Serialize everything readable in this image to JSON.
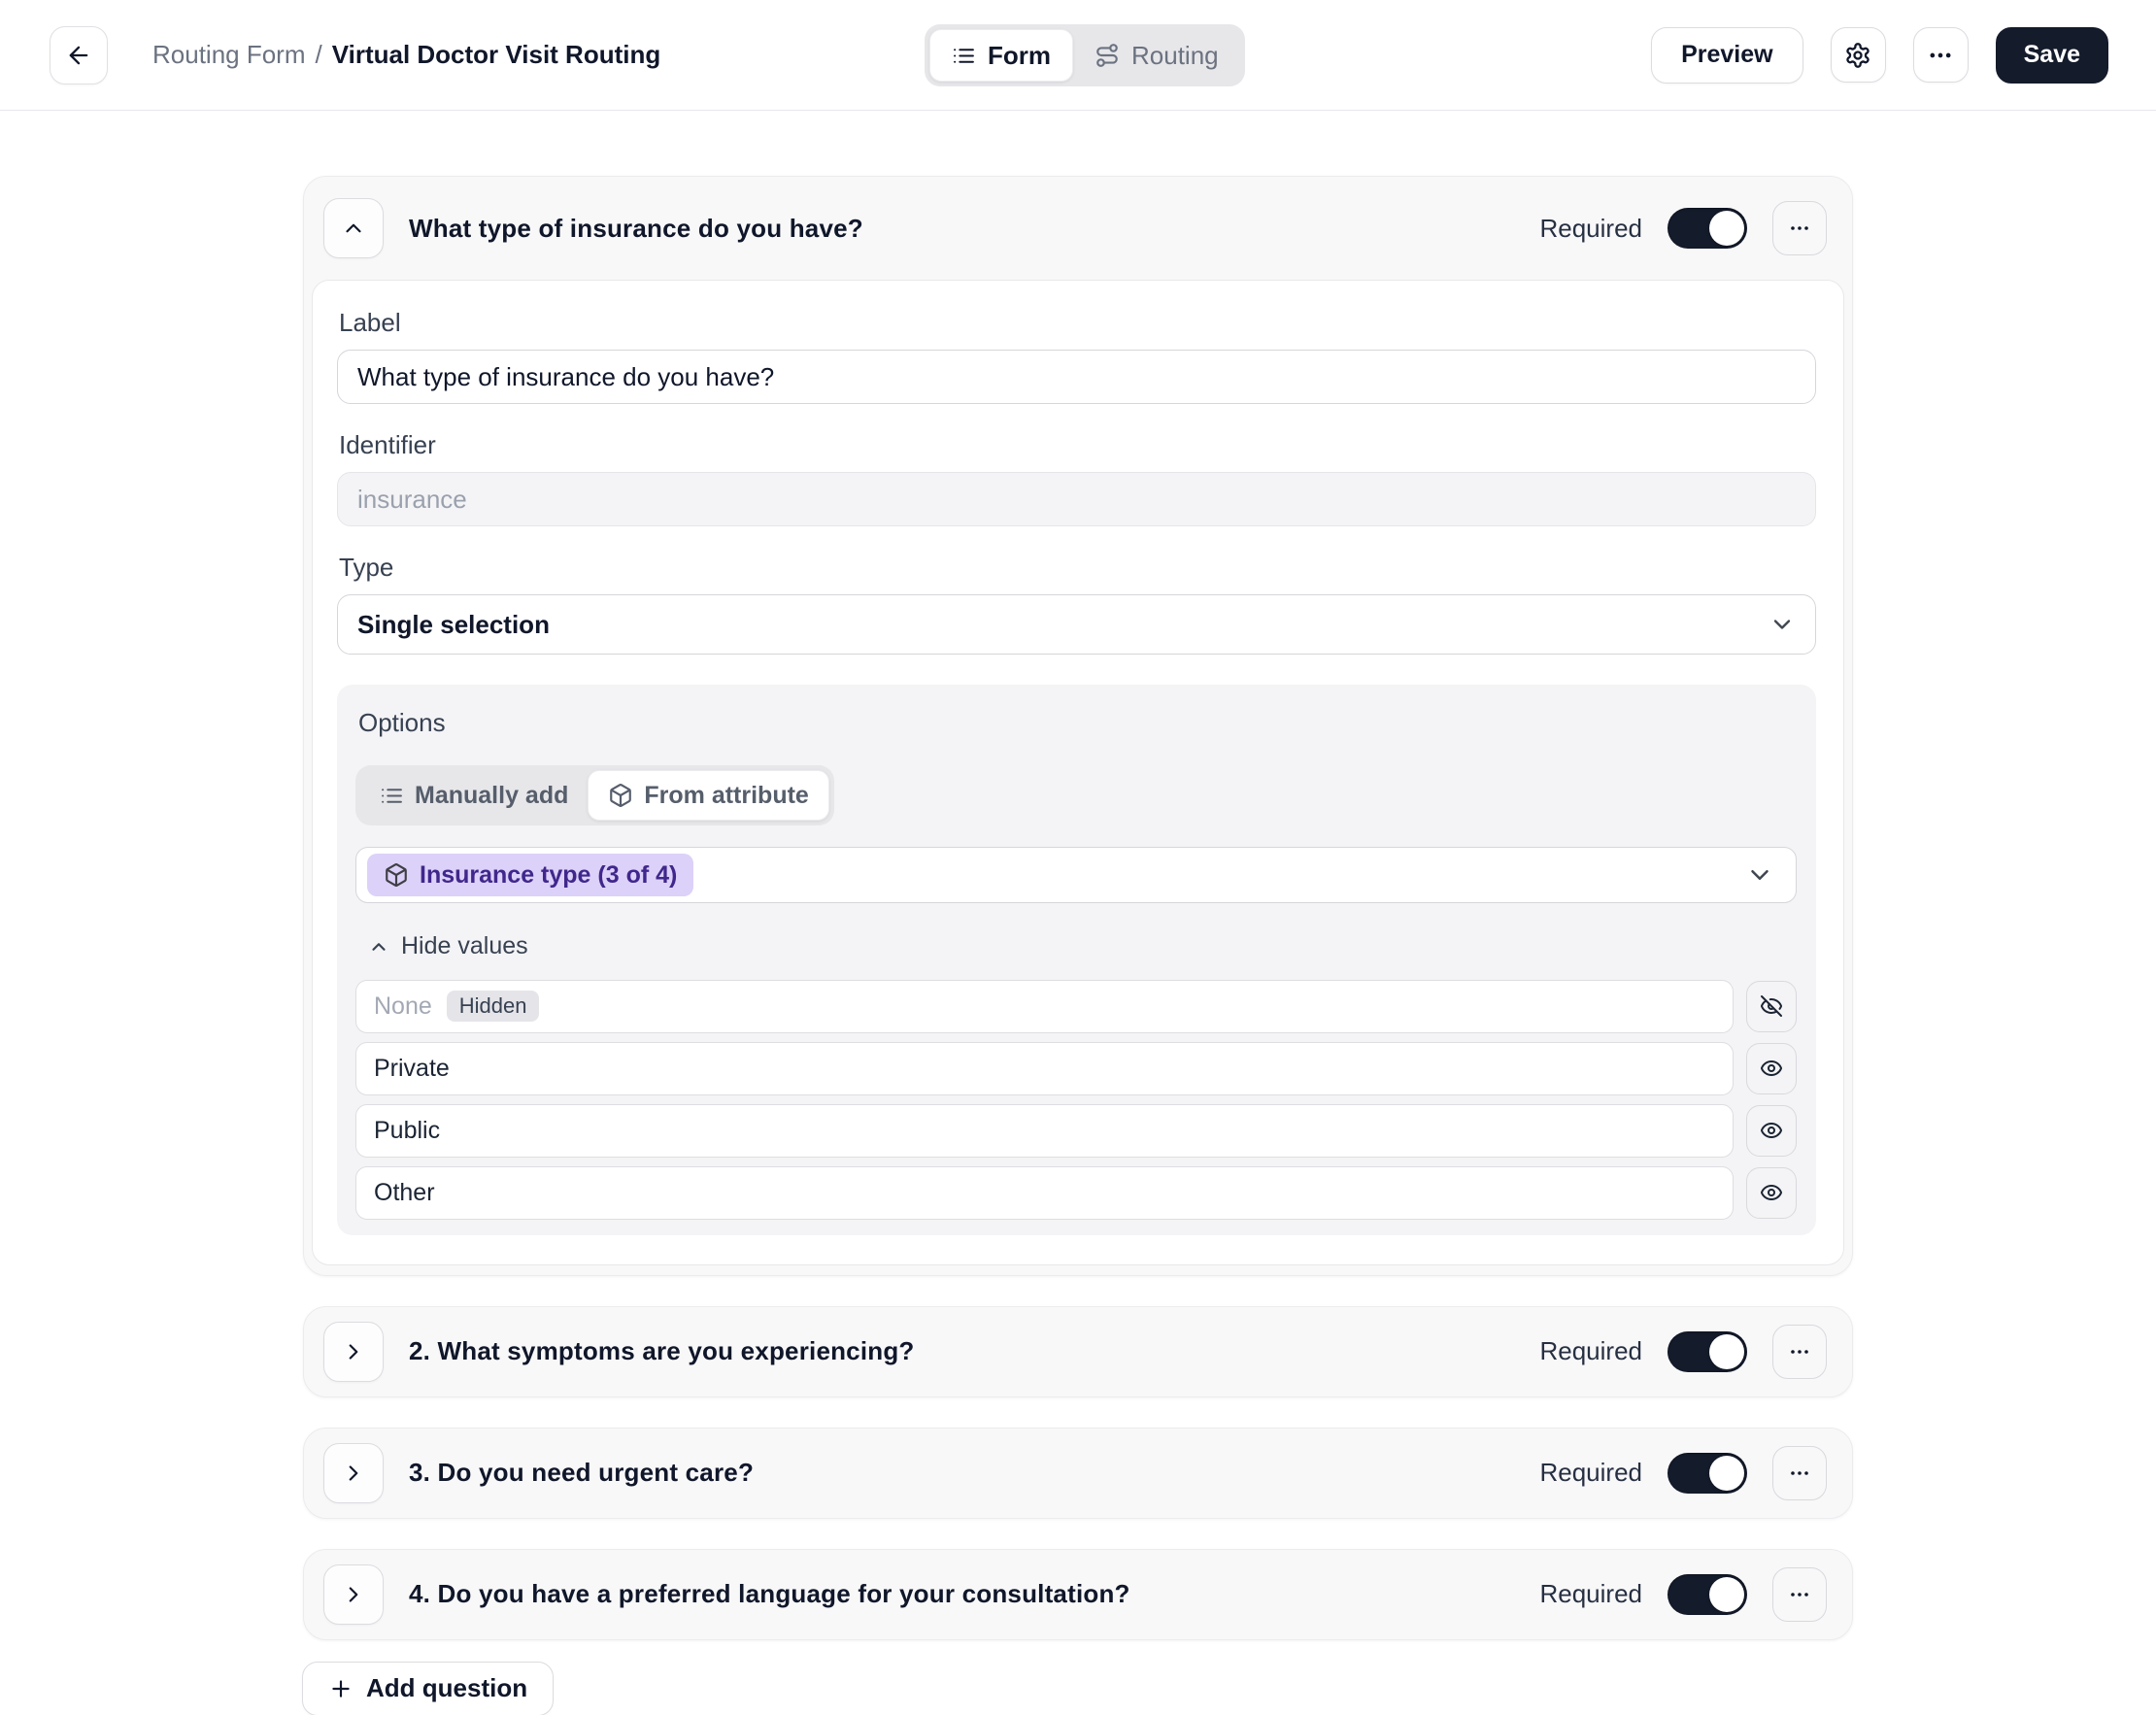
{
  "header": {
    "breadcrumb_section": "Routing Form",
    "breadcrumb_separator": "/",
    "breadcrumb_title": "Virtual Doctor Visit Routing",
    "tabs": [
      {
        "label": "Form",
        "icon": "list-icon",
        "active": true
      },
      {
        "label": "Routing",
        "icon": "route-icon",
        "active": false
      }
    ],
    "preview_label": "Preview",
    "save_label": "Save"
  },
  "question_editor": {
    "title": "What type of insurance do you have?",
    "required_label": "Required",
    "required_on": true,
    "label_field": {
      "label": "Label",
      "value": "What type of insurance do you have?"
    },
    "identifier_field": {
      "label": "Identifier",
      "value": "insurance",
      "disabled": true
    },
    "type_field": {
      "label": "Type",
      "value": "Single selection"
    },
    "options": {
      "title": "Options",
      "source_tabs": [
        {
          "label": "Manually add",
          "icon": "list-icon",
          "active": false
        },
        {
          "label": "From attribute",
          "icon": "box-icon",
          "active": true
        }
      ],
      "attribute_badge": "Insurance type (3 of 4)",
      "hide_values_label": "Hide values",
      "values": [
        {
          "label": "None",
          "hidden": true,
          "badge": "Hidden"
        },
        {
          "label": "Private",
          "hidden": false
        },
        {
          "label": "Public",
          "hidden": false
        },
        {
          "label": "Other",
          "hidden": false
        }
      ]
    }
  },
  "collapsed_questions": [
    {
      "title": "2. What symptoms are you experiencing?",
      "required_label": "Required",
      "required_on": true
    },
    {
      "title": "3. Do you need urgent care?",
      "required_label": "Required",
      "required_on": true
    },
    {
      "title": "4. Do you have a preferred language for your consultation?",
      "required_label": "Required",
      "required_on": true
    }
  ],
  "add_question_label": "Add question",
  "icons": {
    "back": "arrow-left",
    "form_tab": "list",
    "routing_tab": "route",
    "settings": "gear",
    "more": "ellipsis",
    "collapse": "chevron-up",
    "expand": "chevron-right",
    "dropdown": "chevron-down",
    "attribute": "box",
    "visible": "eye",
    "hidden": "eye-off",
    "add": "plus"
  },
  "colors": {
    "save_button_bg": "#141b2b",
    "toggle_on": "#141b2b",
    "attribute_pill_bg": "#dcd1f8",
    "attribute_pill_text": "#40278c",
    "card_bg": "#f8f8f9",
    "options_panel_bg": "#f4f4f6",
    "header_border": "#e8e8ec"
  }
}
